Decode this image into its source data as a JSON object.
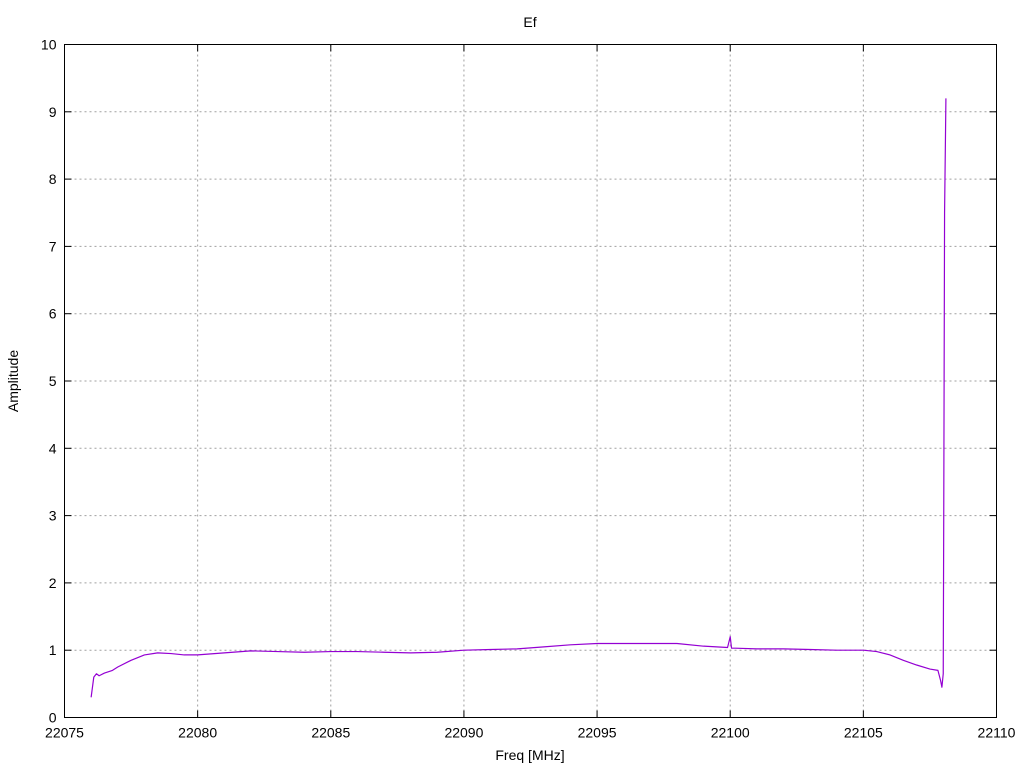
{
  "chart_data": {
    "type": "line",
    "title": "Ef",
    "xlabel": "Freq [MHz]",
    "ylabel": "Amplitude",
    "xlim": [
      22075,
      22110
    ],
    "ylim": [
      0,
      10
    ],
    "xticks": [
      22075,
      22080,
      22085,
      22090,
      22095,
      22100,
      22105,
      22110
    ],
    "yticks": [
      0,
      1,
      2,
      3,
      4,
      5,
      6,
      7,
      8,
      9,
      10
    ],
    "grid": true,
    "legend": "none",
    "series": [
      {
        "color": "#9400d3",
        "x": [
          22076.0,
          22076.1,
          22076.2,
          22076.3,
          22076.5,
          22076.8,
          22077.0,
          22077.5,
          22078.0,
          22078.5,
          22079.0,
          22079.5,
          22080.0,
          22081.0,
          22082.0,
          22083.0,
          22084.0,
          22085.0,
          22086.0,
          22087.0,
          22088.0,
          22089.0,
          22090.0,
          22091.0,
          22092.0,
          22093.0,
          22094.0,
          22095.0,
          22096.0,
          22097.0,
          22098.0,
          22099.0,
          22099.9,
          22100.0,
          22100.05,
          22100.2,
          22101.0,
          22102.0,
          22103.0,
          22104.0,
          22105.0,
          22105.5,
          22106.0,
          22106.5,
          22107.0,
          22107.5,
          22107.8,
          22107.9,
          22107.95,
          22108.0,
          22108.02,
          22108.05,
          22108.08,
          22108.1
        ],
        "y": [
          0.3,
          0.6,
          0.65,
          0.62,
          0.66,
          0.7,
          0.75,
          0.85,
          0.93,
          0.96,
          0.95,
          0.93,
          0.93,
          0.96,
          0.99,
          0.98,
          0.97,
          0.98,
          0.98,
          0.97,
          0.96,
          0.97,
          1.0,
          1.01,
          1.02,
          1.05,
          1.08,
          1.1,
          1.1,
          1.1,
          1.1,
          1.06,
          1.04,
          1.2,
          1.03,
          1.03,
          1.02,
          1.02,
          1.01,
          1.0,
          1.0,
          0.98,
          0.93,
          0.85,
          0.78,
          0.72,
          0.7,
          0.55,
          0.45,
          0.65,
          3.2,
          7.5,
          8.5,
          9.2
        ]
      }
    ]
  }
}
